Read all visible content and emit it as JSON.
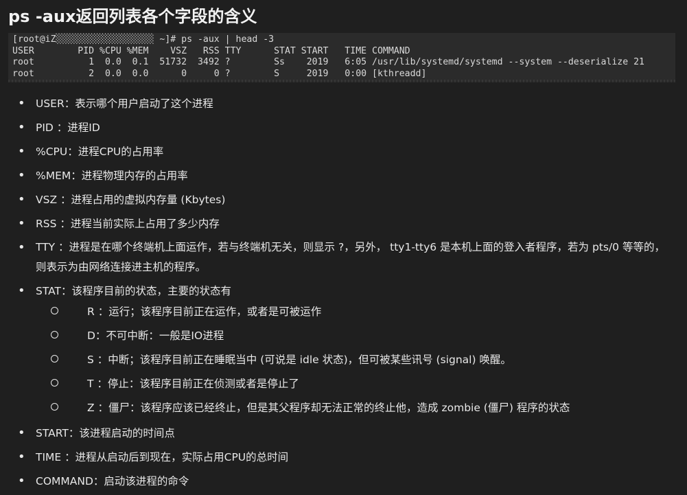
{
  "title": "ps -aux返回列表各个字段的含义",
  "terminal": {
    "lines": [
      "[root@iZ░░░░░░░░░░░░░░░░░░ ~]# ps -aux | head -3",
      "USER        PID %CPU %MEM    VSZ   RSS TTY      STAT START   TIME COMMAND",
      "root          1  0.0  0.1  51732  3492 ?        Ss    2019   6:05 /usr/lib/systemd/systemd --system --deserialize 21",
      "root          2  0.0  0.0      0     0 ?        S     2019   0:00 [kthreadd]"
    ]
  },
  "items": [
    {
      "text": "USER：表示哪个用户启动了这个进程"
    },
    {
      "text": "PID ：进程ID"
    },
    {
      "text": "%CPU：进程CPU的占用率"
    },
    {
      "text": "%MEM：进程物理内存的占用率"
    },
    {
      "text": "VSZ ：进程占用的虚拟内存量 (Kbytes)"
    },
    {
      "text": "RSS ：进程当前实际上占用了多少内存"
    },
    {
      "text": "TTY ：进程是在哪个终端机上面运作，若与终端机无关，则显示 ?，另外， tty1-tty6 是本机上面的登入者程序，若为 pts/0 等等的，则表示为由网络连接进主机的程序。"
    },
    {
      "text": "STAT：该程序目前的状态，主要的状态有"
    },
    {
      "text": "START：该进程启动的时间点"
    },
    {
      "text": "TIME ：进程从启动后到现在，实际占用CPU的总时间"
    },
    {
      "text": "COMMAND：启动该进程的命令"
    }
  ],
  "stat_states": [
    {
      "text": "R ：运行；该程序目前正在运作，或者是可被运作"
    },
    {
      "text": "D：不可中断：一般是IO进程"
    },
    {
      "text": "S ：中断；该程序目前正在睡眠当中 (可说是 idle 状态)，但可被某些讯号 (signal) 唤醒。"
    },
    {
      "text": "T ：停止：该程序目前正在侦测或者是停止了"
    },
    {
      "text": "Z ：僵尸：该程序应该已经终止，但是其父程序却无法正常的终止他，造成 zombie (僵尸) 程序的状态"
    }
  ]
}
